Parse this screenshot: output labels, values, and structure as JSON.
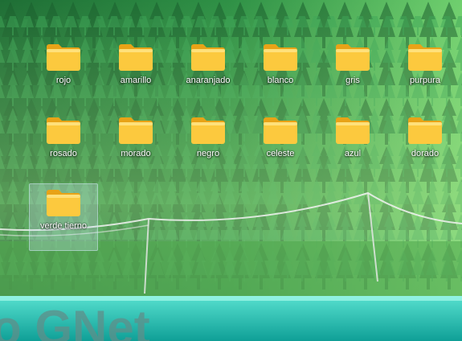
{
  "desktop": {
    "folders": [
      {
        "label": "rojo"
      },
      {
        "label": "amarillo"
      },
      {
        "label": "anaranjado"
      },
      {
        "label": "blanco"
      },
      {
        "label": "gris"
      },
      {
        "label": "purpura"
      },
      {
        "label": "rosado"
      },
      {
        "label": "morado"
      },
      {
        "label": "negro"
      },
      {
        "label": "celeste"
      },
      {
        "label": "azul"
      },
      {
        "label": "dorado"
      },
      {
        "label": "verde tierno",
        "selected": true
      }
    ]
  },
  "wallpaper": {
    "text": "o GNet",
    "colors": {
      "forest": "#2f8a3c",
      "sky": "#8fd18a",
      "water": "#1fc7b4"
    }
  },
  "icon": "folder-icon"
}
